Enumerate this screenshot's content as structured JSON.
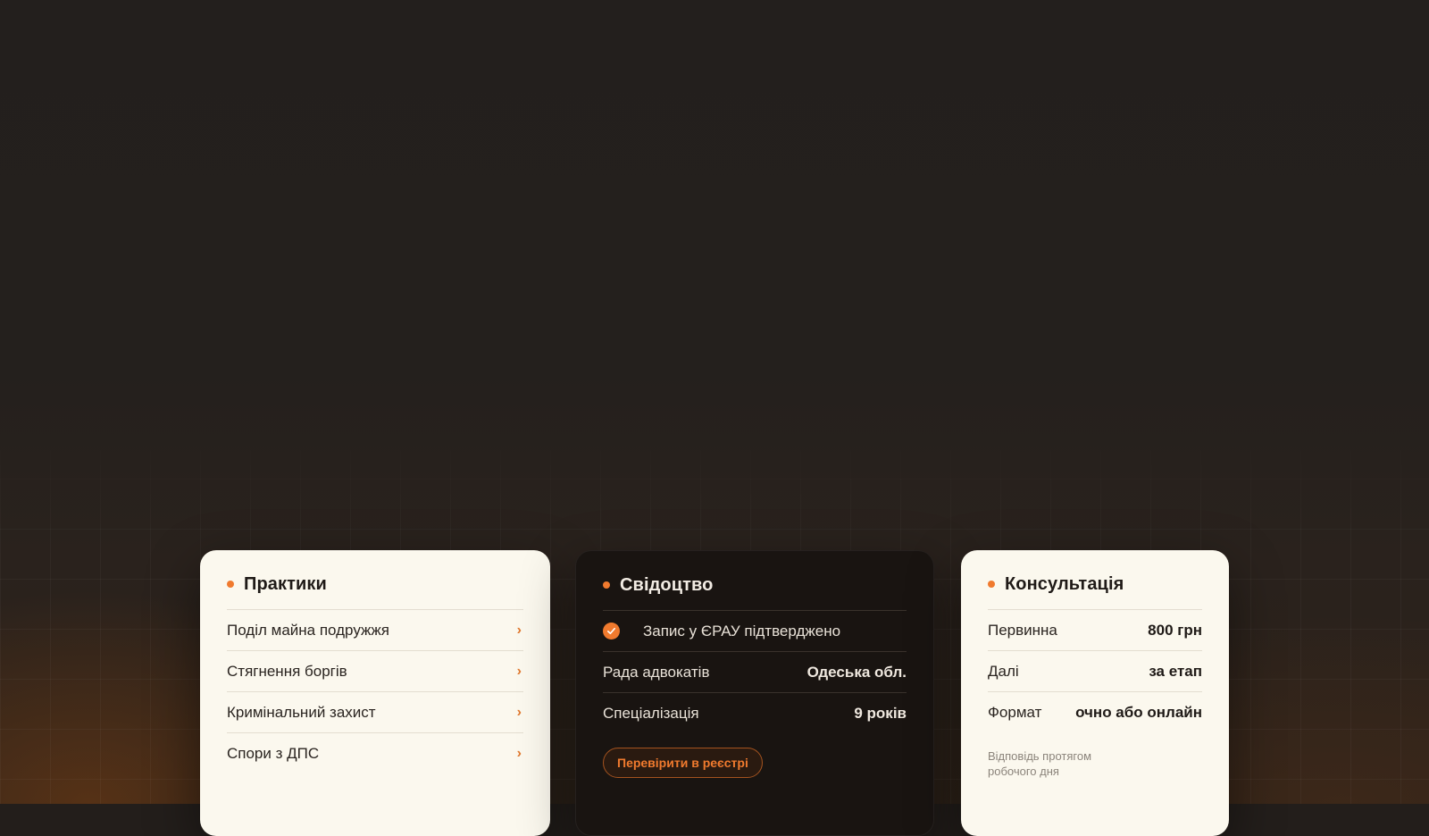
{
  "practices": {
    "title": "Практики",
    "items": [
      {
        "label": "Поділ майна подружжя"
      },
      {
        "label": "Стягнення боргів"
      },
      {
        "label": "Кримінальний захист"
      },
      {
        "label": "Спори з ДПС"
      }
    ],
    "chevron": "›"
  },
  "certificate": {
    "title": "Свідоцтво",
    "verified_label": "Запис у ЄРАУ підтверджено",
    "rows": [
      {
        "label": "Рада адвокатів",
        "value": "Одеська обл."
      },
      {
        "label": "Спеціалізація",
        "value": "9 років"
      }
    ],
    "registry_button": "Перевірити в реєстрі"
  },
  "consultation": {
    "title": "Консультація",
    "rows": [
      {
        "label": "Первинна",
        "value": "800 грн"
      },
      {
        "label": "Далі",
        "value": "за етап"
      },
      {
        "label": "Формат",
        "value": "очно або онлайн"
      }
    ],
    "note": "Відповідь протягом робочого дня"
  },
  "colors": {
    "accent": "#f07a2e",
    "card_light": "#fbf8ee",
    "card_dark": "#191411",
    "page_background": "#231e1b"
  },
  "icons": {
    "bullet": "accent-dot-icon",
    "chevron": "chevron-right-icon",
    "verified": "check-circle-icon"
  }
}
